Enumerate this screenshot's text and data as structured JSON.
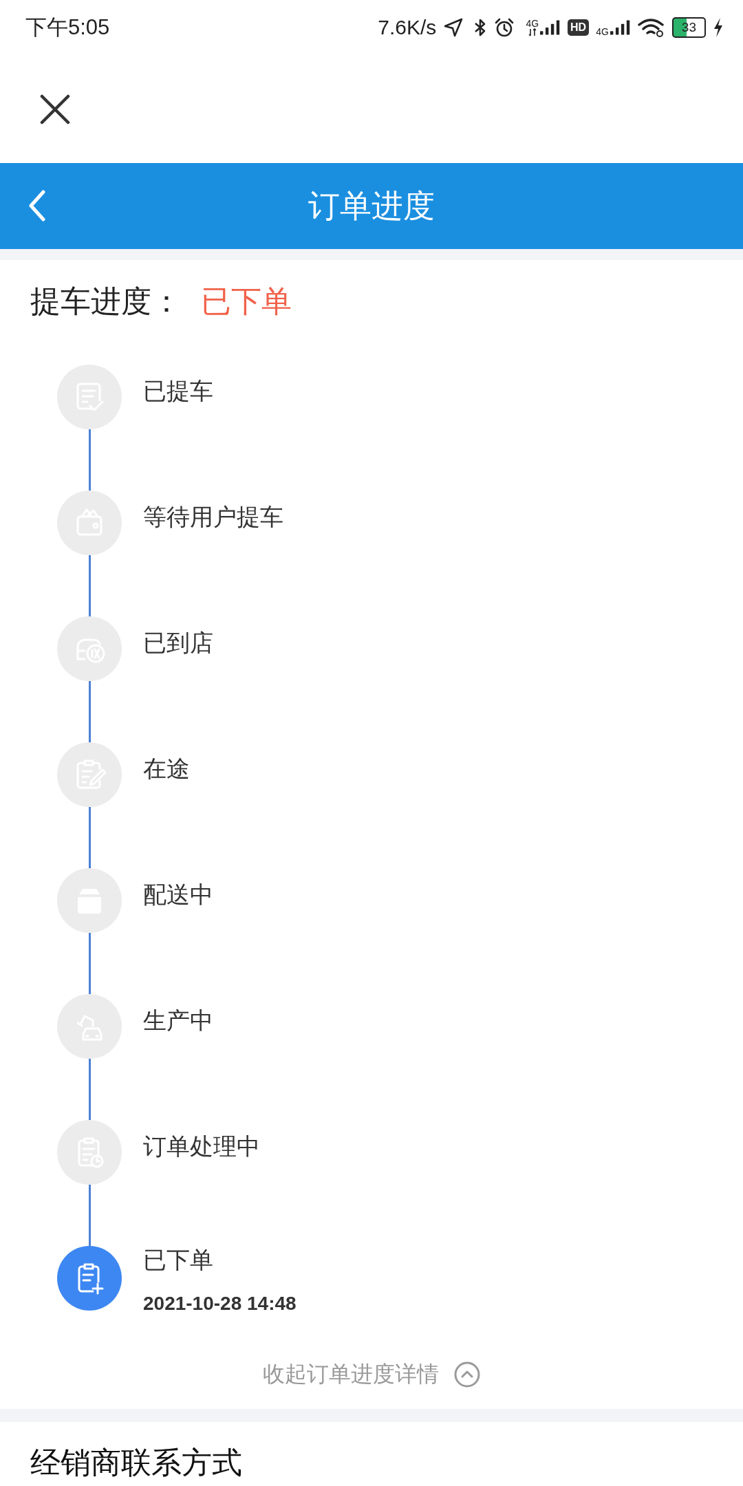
{
  "status_bar": {
    "time": "下午5:05",
    "network_speed": "7.6K/s",
    "sim1_network": "4G",
    "hd_label": "HD",
    "sim2_network": "4G",
    "battery": "33"
  },
  "header": {
    "title": "订单进度"
  },
  "progress": {
    "label": "提车进度：",
    "status": "已下单",
    "steps": [
      {
        "label": "已提车",
        "current": false
      },
      {
        "label": "等待用户提车",
        "current": false
      },
      {
        "label": "已到店",
        "current": false
      },
      {
        "label": "在途",
        "current": false
      },
      {
        "label": "配送中",
        "current": false
      },
      {
        "label": "生产中",
        "current": false
      },
      {
        "label": "订单处理中",
        "current": false
      },
      {
        "label": "已下单",
        "current": true,
        "time": "2021-10-28 14:48"
      }
    ],
    "collapse_label": "收起订单进度详情"
  },
  "dealer_section": {
    "title": "经销商联系方式"
  }
}
